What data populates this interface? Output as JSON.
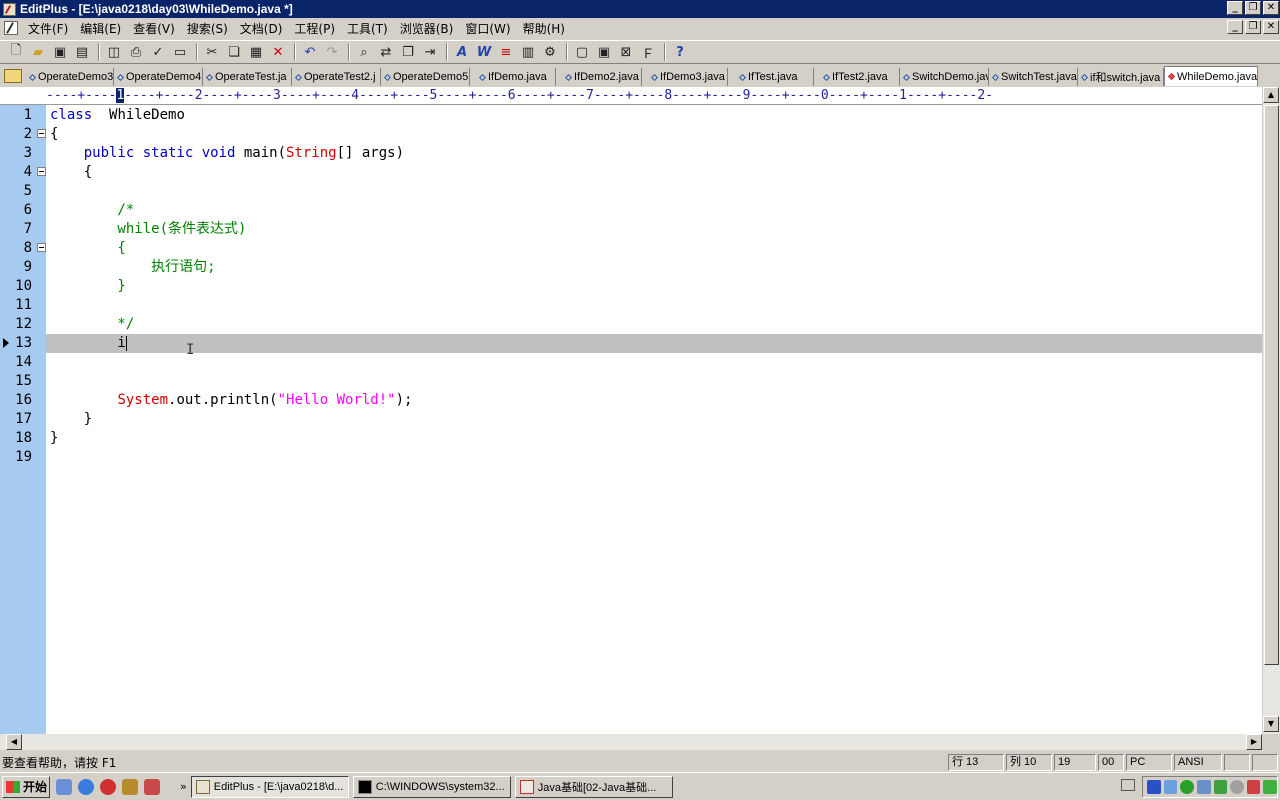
{
  "window": {
    "title": "EditPlus - [E:\\java0218\\day03\\WhileDemo.java *]"
  },
  "menu": [
    "文件(F)",
    "编辑(E)",
    "查看(V)",
    "搜索(S)",
    "文档(D)",
    "工程(P)",
    "工具(T)",
    "浏览器(B)",
    "窗口(W)",
    "帮助(H)"
  ],
  "toolbar_icons": [
    "new-file-icon",
    "open-icon",
    "save-icon",
    "save-all-icon",
    "print-preview-icon",
    "print-icon",
    "spellcheck-icon",
    "document-icon",
    "cut-icon",
    "copy-icon",
    "paste-icon",
    "delete-icon",
    "undo-icon",
    "redo-icon",
    "find-icon",
    "replace-icon",
    "find-files-icon",
    "goto-icon",
    "font-icon",
    "word-wrap-icon",
    "indent-icon",
    "ruler-icon",
    "settings-icon",
    "browser-icon",
    "window-icon",
    "clip-icon",
    "function-icon",
    "help-icon"
  ],
  "tabs": [
    {
      "label": "OperateDemo3.",
      "active": false
    },
    {
      "label": "OperateDemo4.",
      "active": false
    },
    {
      "label": "OperateTest.ja",
      "active": false
    },
    {
      "label": "OperateTest2.j",
      "active": false
    },
    {
      "label": "OperateDemo5.",
      "active": false
    },
    {
      "label": "IfDemo.java",
      "active": false
    },
    {
      "label": "IfDemo2.java",
      "active": false
    },
    {
      "label": "IfDemo3.java",
      "active": false
    },
    {
      "label": "IfTest.java",
      "active": false
    },
    {
      "label": "IfTest2.java",
      "active": false
    },
    {
      "label": "SwitchDemo.jav",
      "active": false
    },
    {
      "label": "SwitchTest.java",
      "active": false
    },
    {
      "label": "if和switch.java",
      "active": false
    },
    {
      "label": "WhileDemo.java",
      "active": true
    }
  ],
  "ruler": {
    "before": "----+----",
    "highlight": "1",
    "after": "----+----2----+----3----+----4----+----5----+----6----+----7----+----8----+----9----+----0----+----1----+----2-"
  },
  "editor": {
    "line_numbers": [
      "1",
      "2",
      "3",
      "4",
      "5",
      "6",
      "7",
      "8",
      "9",
      "10",
      "11",
      "12",
      "13",
      "14",
      "15",
      "16",
      "17",
      "18",
      "19"
    ],
    "current_line": 13,
    "lines": {
      "l1_kw": "class",
      "l1_name": "  WhileDemo",
      "l2": "{",
      "l3_indent": "    ",
      "l3_kw": "public static void",
      "l3_main": " main(",
      "l3_type": "String",
      "l3_rest": "[] args)",
      "l4": "    {",
      "l6": "        /*",
      "l7": "        while(条件表达式)",
      "l8": "        {",
      "l9": "            执行语句;",
      "l10": "        }",
      "l12": "        */",
      "l13": "        i",
      "l16_indent": "        ",
      "l16_type": "System",
      "l16_mid": ".out.println(",
      "l16_str": "\"Hello World!\"",
      "l16_end": ");",
      "l17": "    }",
      "l18": "}"
    }
  },
  "status": {
    "help": "要查看帮助，请按 F1",
    "row": "行 13",
    "col": "列 10",
    "lines": "19",
    "code": "00",
    "mode": "PC",
    "encoding": "ANSI"
  },
  "taskbar": {
    "start": "开始",
    "tasks": [
      {
        "label": "EditPlus - [E:\\java0218\\d...",
        "pressed": true
      },
      {
        "label": "C:\\WINDOWS\\system32...",
        "pressed": false
      },
      {
        "label": "Java基础[02-Java基础...",
        "pressed": false
      }
    ]
  },
  "colors": {
    "keyword": "#0000c0",
    "type": "#d00000",
    "comment": "#008000",
    "string": "#ff00ff",
    "gutter": "#a6caf0",
    "titlebar": "#0a246a"
  }
}
